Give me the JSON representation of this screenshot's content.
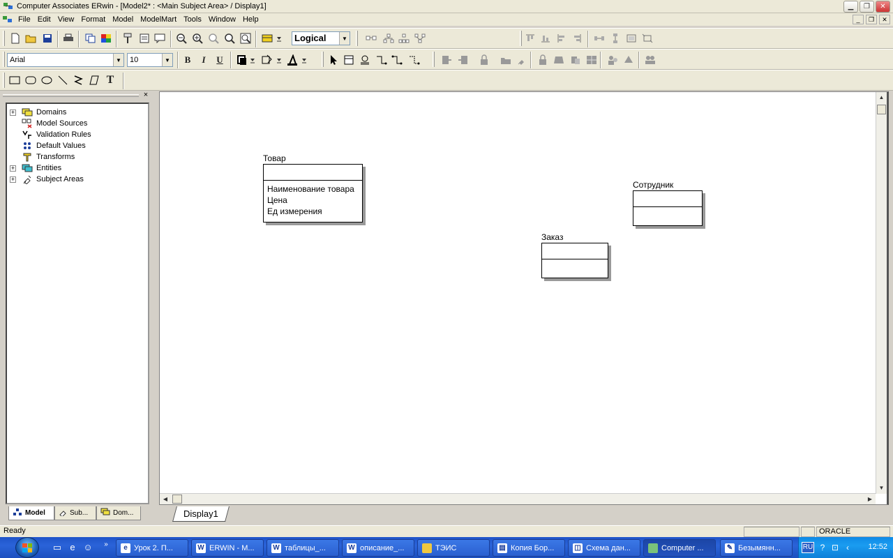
{
  "window": {
    "title": "Computer Associates ERwin - [Model2* : <Main Subject Area> / Display1]"
  },
  "menu": [
    "File",
    "Edit",
    "View",
    "Format",
    "Model",
    "ModelMart",
    "Tools",
    "Window",
    "Help"
  ],
  "toolbar": {
    "view_mode": "Logical",
    "font_name": "Arial",
    "font_size": "10",
    "bold_label": "B",
    "italic_label": "I",
    "underline_label": "U",
    "text_tool_label": "T"
  },
  "tree": {
    "items": [
      {
        "label": "Domains",
        "expandable": true,
        "icon": "domains-icon"
      },
      {
        "label": "Model Sources",
        "expandable": false,
        "icon": "model-sources-icon"
      },
      {
        "label": "Validation Rules",
        "expandable": false,
        "icon": "validation-rules-icon"
      },
      {
        "label": "Default Values",
        "expandable": false,
        "icon": "default-values-icon"
      },
      {
        "label": "Transforms",
        "expandable": false,
        "icon": "transforms-icon"
      },
      {
        "label": "Entities",
        "expandable": true,
        "icon": "entities-icon"
      },
      {
        "label": "Subject Areas",
        "expandable": true,
        "icon": "subject-areas-icon"
      }
    ],
    "plus_symbol": "+"
  },
  "left_tabs": [
    "Model",
    "Sub...",
    "Dom..."
  ],
  "close_symbol": "×",
  "entities": [
    {
      "name": "Товар",
      "attributes": [
        "Наименование товара",
        "Цена",
        "Ед измерения"
      ]
    },
    {
      "name": "Сотрудник",
      "attributes": []
    },
    {
      "name": "Заказ",
      "attributes": []
    }
  ],
  "display_tab": "Display1",
  "status": {
    "text": "Ready",
    "db": "ORACLE"
  },
  "taskbar": {
    "tasks": [
      "Урок 2. П...",
      "ERWIN - M...",
      "таблицы_...",
      "описание_...",
      "ТЭИС",
      "Копия Бор...",
      "Схема дан...",
      "Computer ...",
      "Безымянн..."
    ],
    "lang": "RU",
    "clock": "12:52"
  },
  "colors": {
    "xp_blue": "#2a63d8",
    "tray_blue": "#1a9cf0"
  }
}
